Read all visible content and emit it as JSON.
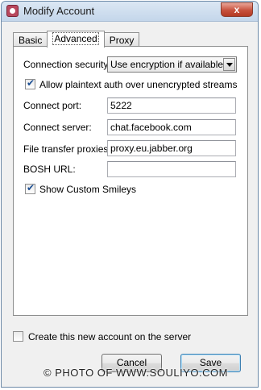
{
  "window": {
    "title": "Modify Account",
    "close_label": "x"
  },
  "tabs": [
    {
      "label": "Basic",
      "active": false
    },
    {
      "label": "Advanced",
      "active": true
    },
    {
      "label": "Proxy",
      "active": false
    }
  ],
  "advanced": {
    "connection_security_label": "Connection security:",
    "connection_security_value": "Use encryption if available",
    "allow_plaintext_label": "Allow plaintext auth over unencrypted streams",
    "allow_plaintext_checked": true,
    "connect_port_label": "Connect port:",
    "connect_port_value": "5222",
    "connect_server_label": "Connect server:",
    "connect_server_value": "chat.facebook.com",
    "file_transfer_label": "File transfer proxies:",
    "file_transfer_value": "proxy.eu.jabber.org",
    "bosh_url_label": "BOSH URL:",
    "bosh_url_value": "",
    "show_smileys_label": "Show Custom Smileys",
    "show_smileys_checked": true
  },
  "footer": {
    "create_account_label": "Create this new account on the server",
    "create_account_checked": false,
    "cancel_label": "Cancel",
    "save_label": "Save"
  },
  "watermark": "© PHOTO OF WWW.SOULIYO.COM"
}
